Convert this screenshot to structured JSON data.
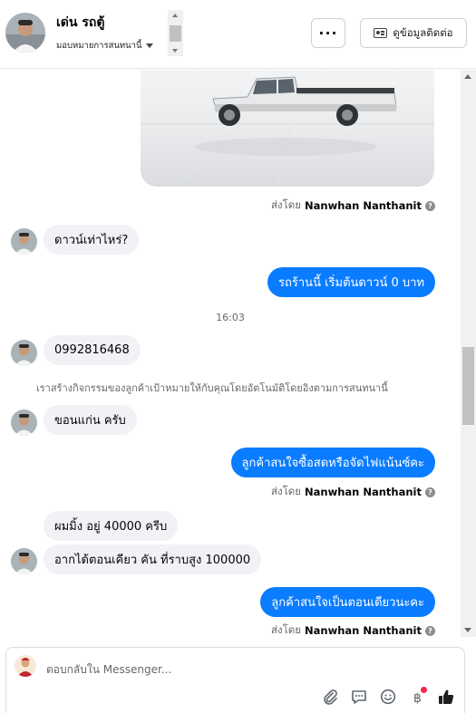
{
  "header": {
    "name": "เด่น รถตู้",
    "subtitle": "มอบหมายการสนทนานี้",
    "more_label": "···",
    "contact_label": "ดูข้อมูลติดต่อ"
  },
  "messages": {
    "sent_by_prefix": "ส่งโดย",
    "sender_name": "Nanwhan Nanthanit",
    "in_1": "ดาวน์เท่าไหร่?",
    "out_1": "รถร้านนี้ เริ่มต้นดาวน์ 0 บาท",
    "timestamp": "16:03",
    "in_2": "0992816468",
    "system_note": "เราสร้างกิจกรรมของลูกค้าเป้าหมายให้กับคุณโดยอัตโนมัติโดยอิงตามการสนทนานี้",
    "in_3": "ขอนแก่น ครับ",
    "out_2": "ลูกค้าสนใจซื้อสดหรือจัดไฟแน้นซ์คะ",
    "in_4": "ผมมิ้ง อยู่ 40000 ครีบ",
    "in_5": "อากได้ตอนเคียว คัน ที่ราบสูง 100000",
    "out_3": "ลูกค้าสนใจเป็นตอนเดียวนะคะ"
  },
  "composer": {
    "placeholder": "ตอบกลับใน Messenger..."
  },
  "colors": {
    "outgoing_bubble": "#0a7cff",
    "incoming_bubble": "#f0f2f5",
    "like_icon": "#1c1e21",
    "notification_dot": "#f02849"
  },
  "icons": [
    "attachment-icon",
    "saved-reply-icon",
    "emoji-icon",
    "payment-icon",
    "like-icon",
    "info-icon"
  ]
}
